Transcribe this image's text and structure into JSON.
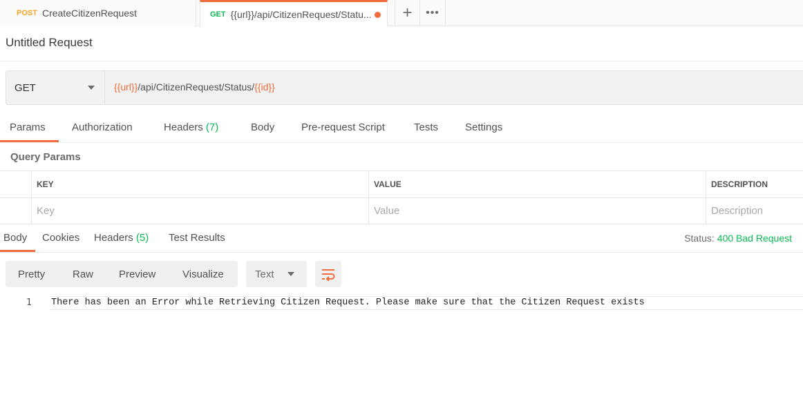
{
  "tabs": [
    {
      "method": "POST",
      "title": "CreateCitizenRequest"
    },
    {
      "method": "GET",
      "title": "{{url}}/api/CitizenRequest/Statu..."
    }
  ],
  "tab_actions": {
    "add": "+",
    "more": "•••"
  },
  "request": {
    "name": "Untitled Request",
    "method": "GET",
    "url_parts": {
      "var_url": "{{url}}",
      "path": "/api/CitizenRequest/Status/",
      "var_id": "{{id}}"
    }
  },
  "request_tabs": {
    "params": "Params",
    "authorization": "Authorization",
    "headers": "Headers",
    "headers_count": "(7)",
    "body": "Body",
    "prerequest": "Pre-request Script",
    "tests": "Tests",
    "settings": "Settings"
  },
  "query_params": {
    "title": "Query Params",
    "columns": [
      "KEY",
      "VALUE",
      "DESCRIPTION"
    ],
    "placeholders": [
      "Key",
      "Value",
      "Description"
    ]
  },
  "response_tabs": {
    "body": "Body",
    "cookies": "Cookies",
    "headers": "Headers",
    "headers_count": "(5)",
    "test_results": "Test Results"
  },
  "status": {
    "label": "Status:",
    "value": "400 Bad Request"
  },
  "response_toolbar": {
    "pretty": "Pretty",
    "raw": "Raw",
    "preview": "Preview",
    "visualize": "Visualize",
    "language": "Text"
  },
  "response_body": {
    "line_number": "1",
    "text": "There has been an Error while Retrieving Citizen Request. Please make sure that the Citizen Request exists"
  },
  "colors": {
    "accent": "#f26b3a",
    "get": "#0cbb52",
    "post": "#f5a623",
    "status_ok": "#0cbb52"
  }
}
